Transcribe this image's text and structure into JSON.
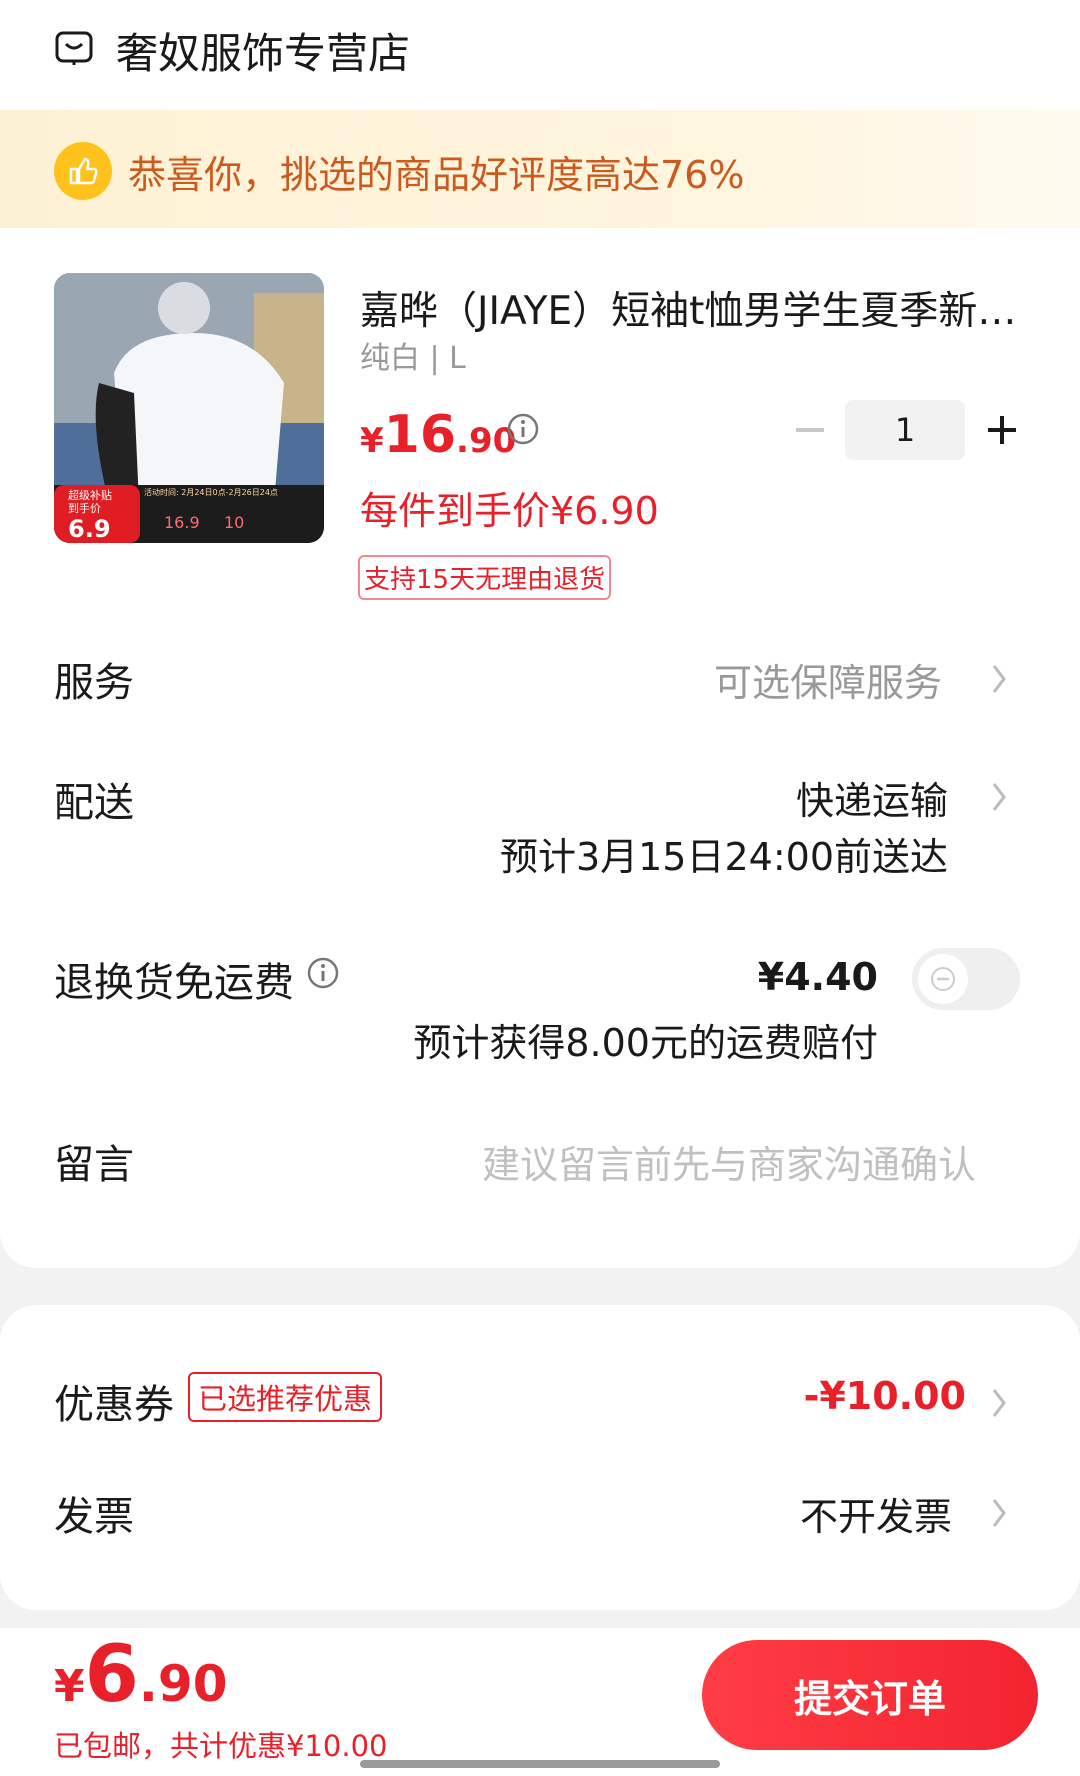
{
  "store": {
    "name": "奢奴服饰专营店",
    "icon": "store-icon"
  },
  "banner": {
    "icon": "thumbs-up-icon",
    "text": "恭喜你，挑选的商品好评度高达76%"
  },
  "product": {
    "title": "嘉晔（JIAYE）短袖t恤男学生夏季新…",
    "spec": "纯白 | L",
    "price_symbol": "¥",
    "price_integer": "16",
    "price_decimal": ".90",
    "quantity": "1",
    "final_price": "每件到手价¥6.90",
    "return_tag": "支持15天无理由退货",
    "image_badge": {
      "top_line": "超级补贴",
      "sub_line": "到手价",
      "price": "6.9",
      "activity": "活动时间: 2月24日0点-2月26日24点",
      "orig": "16.9",
      "discount": "10"
    }
  },
  "rows": {
    "service": {
      "label": "服务",
      "value": "可选保障服务"
    },
    "delivery": {
      "label": "配送",
      "value": "快递运输",
      "sub": "预计3月15日24:00前送达"
    },
    "return_shipping": {
      "label": "退换货免运费",
      "value": "¥4.40",
      "sub": "预计获得8.00元的运费赔付",
      "toggle_on": false
    },
    "message": {
      "label": "留言",
      "placeholder": "建议留言前先与商家沟通确认"
    }
  },
  "discount": {
    "coupon_label": "优惠券",
    "coupon_tag": "已选推荐优惠",
    "coupon_value": "-¥10.00",
    "invoice_label": "发票",
    "invoice_value": "不开发票"
  },
  "bottom": {
    "total_symbol": "¥",
    "total_integer": "6",
    "total_decimal": ".90",
    "shipping_note": "已包邮，",
    "discount_note": "共计优惠¥10.00",
    "submit_label": "提交订单"
  },
  "colors": {
    "accent": "#e8202a",
    "banner_text": "#cc5a1f",
    "banner_icon": "#ffc21c"
  }
}
